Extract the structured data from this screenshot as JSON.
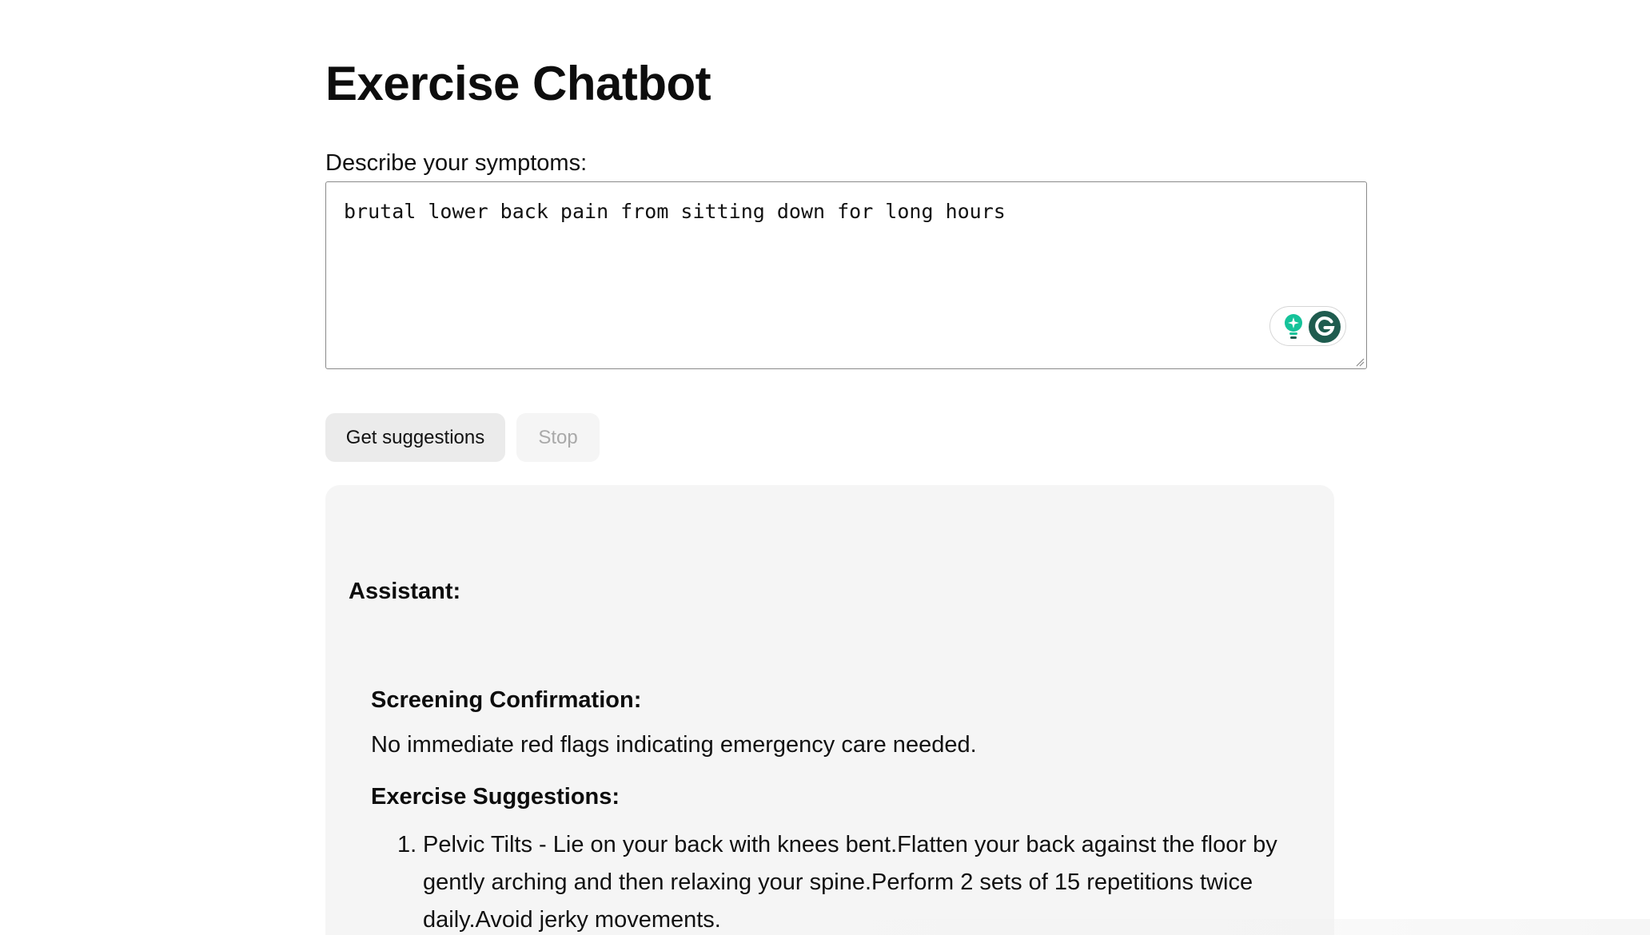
{
  "page": {
    "title": "Exercise Chatbot"
  },
  "form": {
    "symptoms_label": "Describe your symptoms:",
    "symptoms_value": "brutal lower back pain from sitting down for long hours",
    "get_suggestions_label": "Get suggestions",
    "stop_label": "Stop",
    "stop_disabled": true
  },
  "grammarly": {
    "icons": [
      "lightbulb-icon",
      "grammarly-g-icon"
    ],
    "accent": "#15C39A",
    "brand": "#1f5c4f"
  },
  "response": {
    "assistant_label": "Assistant:",
    "screening_heading": "Screening Confirmation:",
    "screening_text": "No immediate red flags indicating emergency care needed.",
    "exercise_heading": "Exercise Suggestions:",
    "exercises": [
      {
        "number": "1.",
        "text": "Pelvic Tilts - Lie on your back with knees bent.Flatten your back against the floor by gently arching and then relaxing your spine.Perform 2 sets of 15 repetitions twice daily.Avoid jerky movements."
      }
    ]
  },
  "colors": {
    "panel_background": "#f5f5f5",
    "button_background": "#ebebeb",
    "disabled_text": "#a9a9a9"
  }
}
